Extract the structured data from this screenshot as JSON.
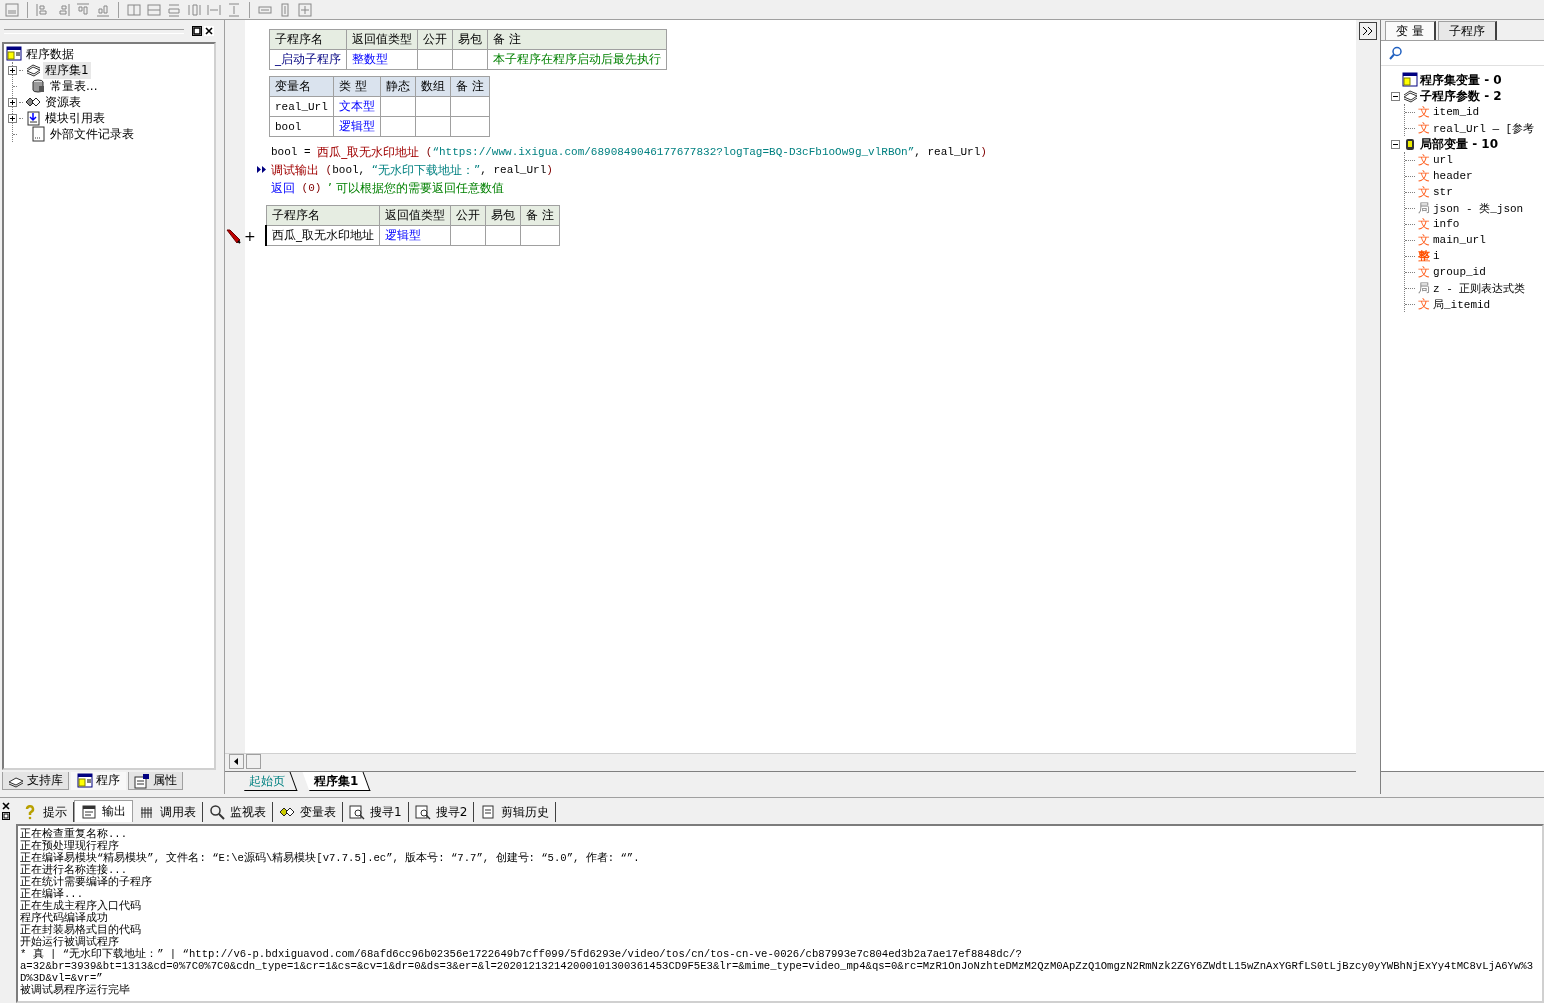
{
  "left_panel": {
    "tree": [
      {
        "label": "程序数据",
        "kind": "program",
        "selected": false,
        "children": [
          {
            "label": "程序集1",
            "kind": "set",
            "selected": true,
            "expanded": false
          },
          {
            "label": "常量表...",
            "kind": "constant",
            "selected": false
          },
          {
            "label": "资源表",
            "kind": "resource",
            "selected": false,
            "expanded": false
          },
          {
            "label": "模块引用表",
            "kind": "module",
            "selected": false,
            "expanded": false
          },
          {
            "label": "外部文件记录表",
            "kind": "file",
            "selected": false
          }
        ]
      }
    ],
    "tabs": [
      {
        "label": "支持库",
        "kind": "library",
        "selected": false
      },
      {
        "label": "程序",
        "kind": "program",
        "selected": true
      },
      {
        "label": "属性",
        "kind": "property",
        "selected": false
      }
    ]
  },
  "editor": {
    "sub_table": {
      "columns": [
        "子程序名",
        "返回值类型",
        "公开",
        "易包",
        "备 注"
      ],
      "row": {
        "name": "_启动子程序",
        "return_type": "整数型",
        "remark": "本子程序在程序启动后最先执行"
      }
    },
    "var_table": {
      "columns": [
        "变量名",
        "类 型",
        "静态",
        "数组",
        "备 注"
      ],
      "rows": [
        {
          "name": "real_Url",
          "type": "文本型"
        },
        {
          "name": "bool",
          "type": "逻辑型"
        }
      ]
    },
    "code_lines": [
      {
        "marker": false,
        "segments": [
          {
            "kind": "var",
            "text": "bool"
          },
          {
            "kind": "op",
            "text": " = "
          },
          {
            "kind": "call",
            "text": "西瓜_取无水印地址"
          },
          {
            "kind": "paren",
            "text": " ("
          },
          {
            "kind": "string",
            "text": "“https://www.ixigua.com/6890849046177677832?logTag=BQ-D3cFb1oOw9g_vlRBOn”"
          },
          {
            "kind": "op",
            "text": ", "
          },
          {
            "kind": "var",
            "text": "real_Url"
          },
          {
            "kind": "paren",
            "text": ")"
          }
        ]
      },
      {
        "marker": true,
        "segments": [
          {
            "kind": "call",
            "text": "调试输出"
          },
          {
            "kind": "paren",
            "text": " ("
          },
          {
            "kind": "var",
            "text": "bool"
          },
          {
            "kind": "op",
            "text": ", "
          },
          {
            "kind": "string",
            "text": "“无水印下载地址：”"
          },
          {
            "kind": "op",
            "text": ", "
          },
          {
            "kind": "var",
            "text": "real_Url"
          },
          {
            "kind": "paren",
            "text": ")"
          }
        ]
      },
      {
        "marker": false,
        "segments": [
          {
            "kind": "keyword",
            "text": "返回"
          },
          {
            "kind": "paren",
            "text": " (0) "
          },
          {
            "kind": "comment",
            "text": "’ 可以根据您的需要返回任意数值"
          }
        ]
      }
    ],
    "sub_table_2": {
      "add_mark": "+",
      "columns": [
        "子程序名",
        "返回值类型",
        "公开",
        "易包",
        "备 注"
      ],
      "row": {
        "name": "西瓜_取无水印地址",
        "return_type": "逻辑型"
      }
    },
    "tabs": [
      {
        "label": "起始页",
        "selected": false
      },
      {
        "label": "程序集1",
        "selected": true
      }
    ]
  },
  "right_panel": {
    "tabs": [
      {
        "label": "变 量",
        "selected": true
      },
      {
        "label": "子程序",
        "selected": false
      }
    ],
    "tree": [
      {
        "label": "程序集变量 - 0",
        "kind": "set-vars"
      },
      {
        "label": "子程序参数 - 2",
        "kind": "params",
        "expanded": true,
        "children": [
          {
            "glyph": "文",
            "kind": "text",
            "label": "item_id"
          },
          {
            "glyph": "文",
            "kind": "text",
            "label": "real_Url — [参考"
          }
        ]
      },
      {
        "label": "局部变量 - 10",
        "kind": "locals",
        "expanded": true,
        "children": [
          {
            "glyph": "文",
            "kind": "text",
            "label": "url"
          },
          {
            "glyph": "文",
            "kind": "text",
            "label": "header"
          },
          {
            "glyph": "文",
            "kind": "text",
            "label": "str"
          },
          {
            "glyph": "局",
            "kind": "class",
            "label": "json - 类_json"
          },
          {
            "glyph": "文",
            "kind": "text",
            "label": "info"
          },
          {
            "glyph": "文",
            "kind": "text",
            "label": "main_url"
          },
          {
            "glyph": "整",
            "kind": "int",
            "label": "i"
          },
          {
            "glyph": "文",
            "kind": "text",
            "label": "group_id"
          },
          {
            "glyph": "局",
            "kind": "class",
            "label": "z - 正则表达式类"
          },
          {
            "glyph": "文",
            "kind": "text",
            "label": "局_itemid"
          }
        ]
      }
    ]
  },
  "bottom_panel": {
    "tabs": [
      {
        "label": "提示",
        "kind": "hint",
        "selected": false
      },
      {
        "label": "输出",
        "kind": "output",
        "selected": true
      },
      {
        "label": "调用表",
        "kind": "calls",
        "selected": false
      },
      {
        "label": "监视表",
        "kind": "watch",
        "selected": false
      },
      {
        "label": "变量表",
        "kind": "vars",
        "selected": false
      },
      {
        "label": "搜寻1",
        "kind": "find",
        "selected": false
      },
      {
        "label": "搜寻2",
        "kind": "find",
        "selected": false
      },
      {
        "label": "剪辑历史",
        "kind": "clip",
        "selected": false
      }
    ],
    "output": [
      "正在检查重复名称...",
      "正在预处理现行程序",
      "正在编译易模块“精易模块”, 文件名: “E:\\e源码\\精易模块[v7.7.5].ec”, 版本号: “7.7”, 创建号: “5.0”, 作者: “”.",
      "正在进行名称连接...",
      "正在统计需要编译的子程序",
      "正在编译...",
      "正在生成主程序入口代码",
      "程序代码编译成功",
      "正在封装易格式目的代码",
      "开始运行被调试程序",
      "* 真 | “无水印下载地址：” | “http://v6-p.bdxiguavod.com/68afd6cc96b02356e1722649b7cff099/5fd6293e/video/tos/cn/tos-cn-ve-0026/cb87993e7c804ed3b2a7ae17ef8848dc/?",
      "a=32&br=3939&bt=1313&cd=0%7C0%7C0&cdn_type=1&cr=1&cs=&cv=1&dr=0&ds=3&er=&l=202012132142000101300361453CD9F5E3&lr=&mime_type=video_mp4&qs=0&rc=MzR1OnJoNzhteDMzM2QzM0ApZzQ1OmgzN2RmNzk2ZGY6ZWdtL15wZnAxYGRfLS0tLjBzcy0yYWBhNjExYy4tMC8vLjA6Yw%3D%3D&vl=&vr=”",
      "被调试易程序运行完毕"
    ]
  }
}
